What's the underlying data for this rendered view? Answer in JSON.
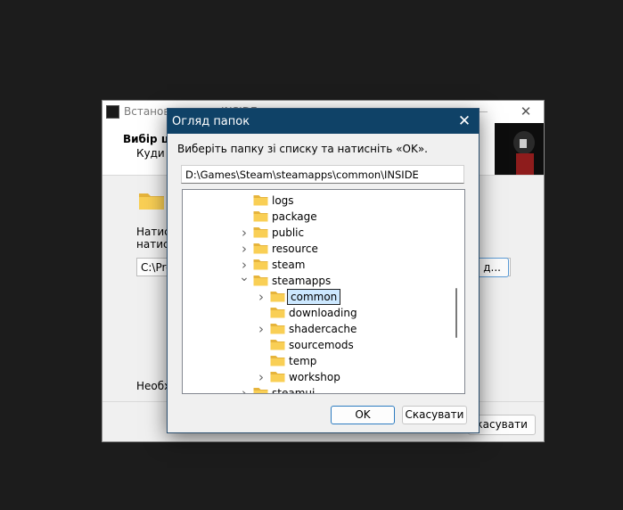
{
  "installer": {
    "title": "Встановлення — INSIDE",
    "header_title": "Вибір шл",
    "header_subtitle": "Куди в",
    "text_line1": "Натисн",
    "text_line2": "натисн",
    "path_value": "C:\\Pro",
    "browse_label": "д...",
    "required_text": "Необхі",
    "cancel_label": "Скасувати",
    "close_glyph": "✕",
    "logo_icon": "inside-logo-icon",
    "folder_icon": "folder-icon"
  },
  "dialog": {
    "title": "Огляд папок",
    "close_glyph": "✕",
    "instruction": "Виберіть папку зі списку та натисніть «OK».",
    "path_value": "D:\\Games\\Steam\\steamapps\\common\\INSIDE",
    "ok_label": "OK",
    "cancel_label": "Скасувати",
    "tree": [
      {
        "label": "logs",
        "depth": 1,
        "expander": "none",
        "selected": false
      },
      {
        "label": "package",
        "depth": 1,
        "expander": "none",
        "selected": false
      },
      {
        "label": "public",
        "depth": 1,
        "expander": "collapsed",
        "selected": false
      },
      {
        "label": "resource",
        "depth": 1,
        "expander": "collapsed",
        "selected": false
      },
      {
        "label": "steam",
        "depth": 1,
        "expander": "collapsed",
        "selected": false
      },
      {
        "label": "steamapps",
        "depth": 1,
        "expander": "expanded",
        "selected": false
      },
      {
        "label": "common",
        "depth": 2,
        "expander": "collapsed",
        "selected": true
      },
      {
        "label": "downloading",
        "depth": 2,
        "expander": "none",
        "selected": false
      },
      {
        "label": "shadercache",
        "depth": 2,
        "expander": "collapsed",
        "selected": false
      },
      {
        "label": "sourcemods",
        "depth": 2,
        "expander": "none",
        "selected": false
      },
      {
        "label": "temp",
        "depth": 2,
        "expander": "none",
        "selected": false
      },
      {
        "label": "workshop",
        "depth": 2,
        "expander": "collapsed",
        "selected": false
      },
      {
        "label": "steamui",
        "depth": 1,
        "expander": "collapsed",
        "selected": false
      }
    ]
  },
  "colors": {
    "dialog_titlebar": "#0f4267",
    "folder_fill": "#f9cf55",
    "folder_tab": "#e6b43c",
    "selection_fill": "#cce8ff",
    "accent_border": "#2d7cc1"
  }
}
